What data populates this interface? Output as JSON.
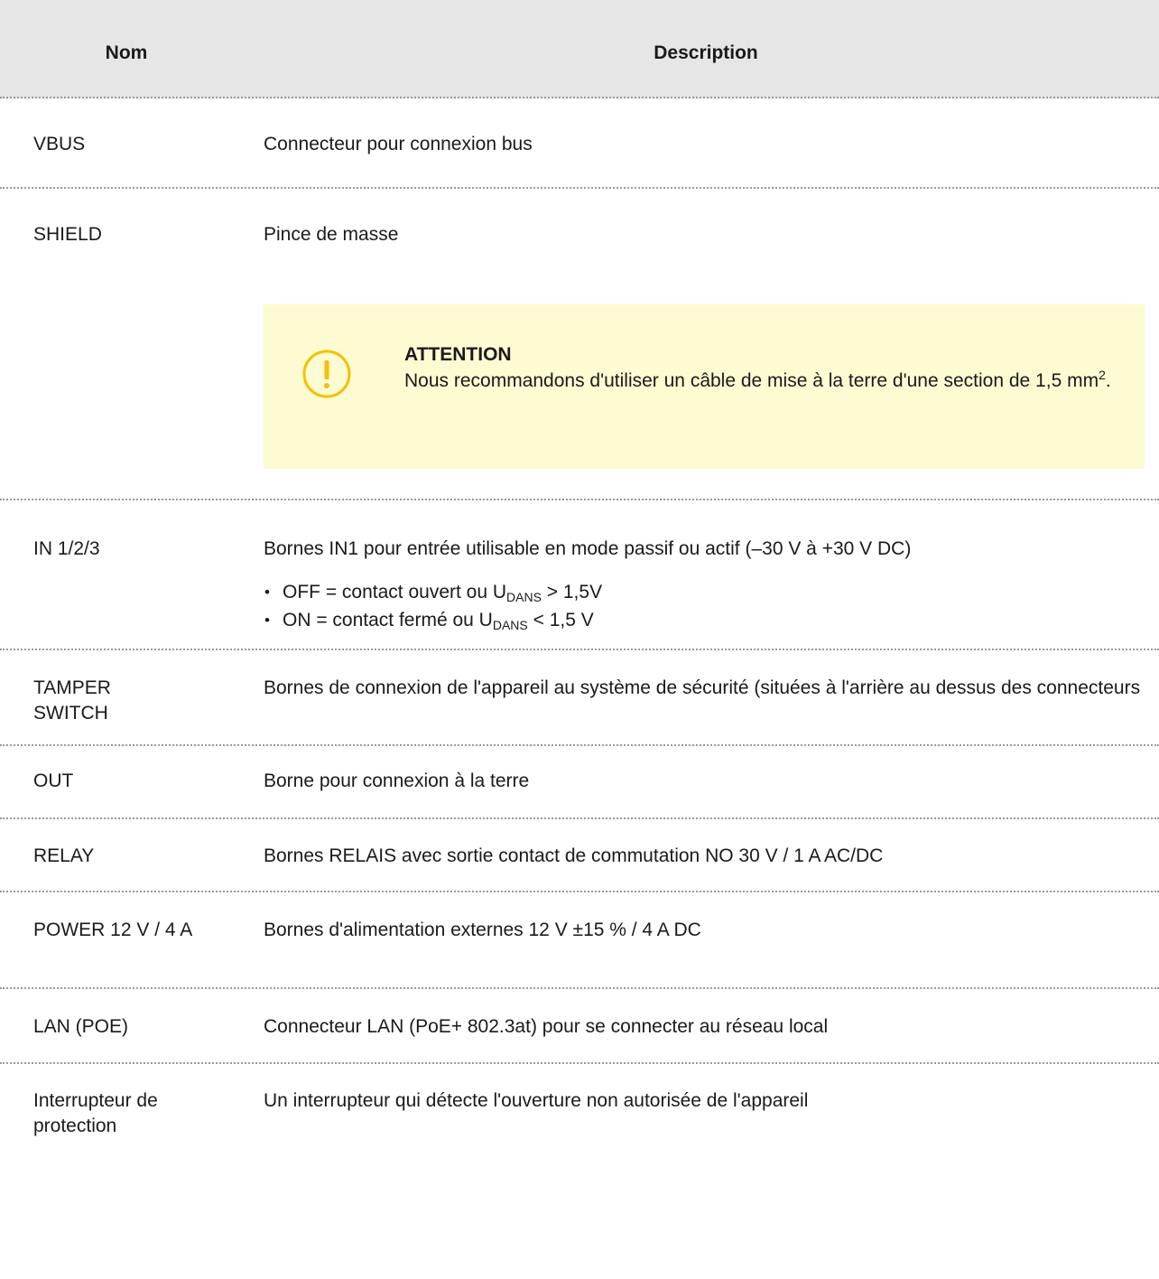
{
  "header": {
    "name": "Nom",
    "description": "Description"
  },
  "rows": [
    {
      "name": "VBUS",
      "description": "Connecteur pour connexion bus"
    },
    {
      "name": "SHIELD",
      "description": "Pince de masse",
      "notice": {
        "icon": "warning-circle-icon",
        "color": "#f5c000",
        "background": "#fdfbd2",
        "title": "ATTENTION",
        "text_before": "Nous recommandons d'utiliser un câble de mise à la terre d'une section de 1,5 mm",
        "sup": "2",
        "text_after": "."
      }
    },
    {
      "name": "IN 1/2/3",
      "description": "Bornes IN1 pour entrée utilisable en mode passif ou actif (–30 V à +30 V DC)",
      "bullets": [
        {
          "before": "OFF = contact ouvert ou U",
          "sub": "DANS",
          "after": " > 1,5V"
        },
        {
          "before": "ON = contact fermé ou U",
          "sub": "DANS",
          "after": " < 1,5 V"
        }
      ]
    },
    {
      "name": "TAMPER SWITCH",
      "description": "Bornes de connexion de l'appareil au système de sécurité (situées à l'arrière au dessus des connecteurs"
    },
    {
      "name": "OUT",
      "description": "Borne pour connexion à la terre"
    },
    {
      "name": "RELAY",
      "description": "Bornes RELAIS avec sortie contact de commutation NO 30 V / 1 A AC/DC"
    },
    {
      "name": "POWER 12 V / 4 A",
      "description": "Bornes d'alimentation externes 12 V ±15 % / 4 A DC"
    },
    {
      "name": "LAN (POE)",
      "description": "Connecteur LAN (PoE+ 802.3at) pour se connecter au réseau local"
    },
    {
      "name": "Interrupteur de protection",
      "description": "Un interrupteur qui détecte l'ouverture non autorisée de l'appareil"
    }
  ]
}
